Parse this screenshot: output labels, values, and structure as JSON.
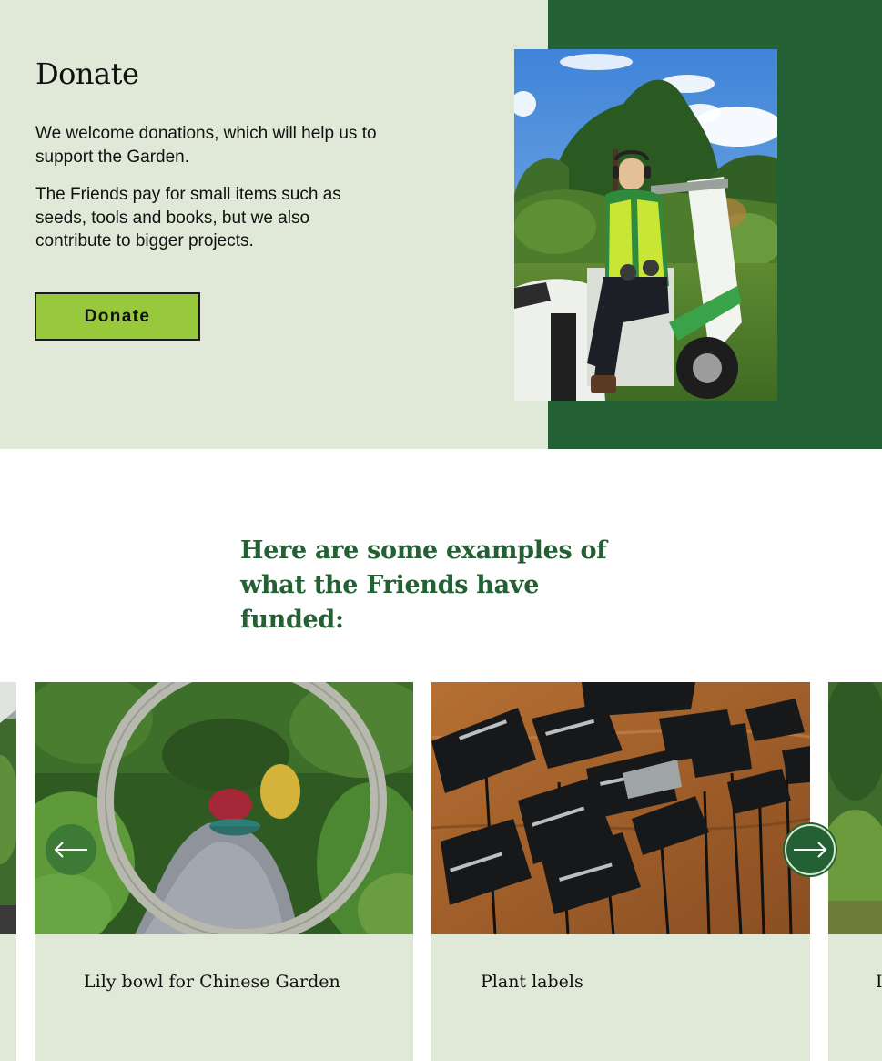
{
  "donate": {
    "title": "Donate",
    "paragraph_1": "We welcome donations, which will help us to support the Garden.",
    "paragraph_2": "The Friends pay for small items such as seeds, tools and books, but we also contribute to bigger projects.",
    "button_label": "Donate"
  },
  "funded": {
    "heading": "Here are some examples of what the Friends have funded:",
    "cards": [
      {
        "title": "Lily bowl for Chinese Garden"
      },
      {
        "title": "Plant labels"
      }
    ],
    "prev_icon": "arrow-left-icon",
    "next_icon": "arrow-right-icon"
  },
  "colors": {
    "light_green": "#e0e9d7",
    "dark_green": "#236033",
    "button_green": "#98c93c"
  }
}
